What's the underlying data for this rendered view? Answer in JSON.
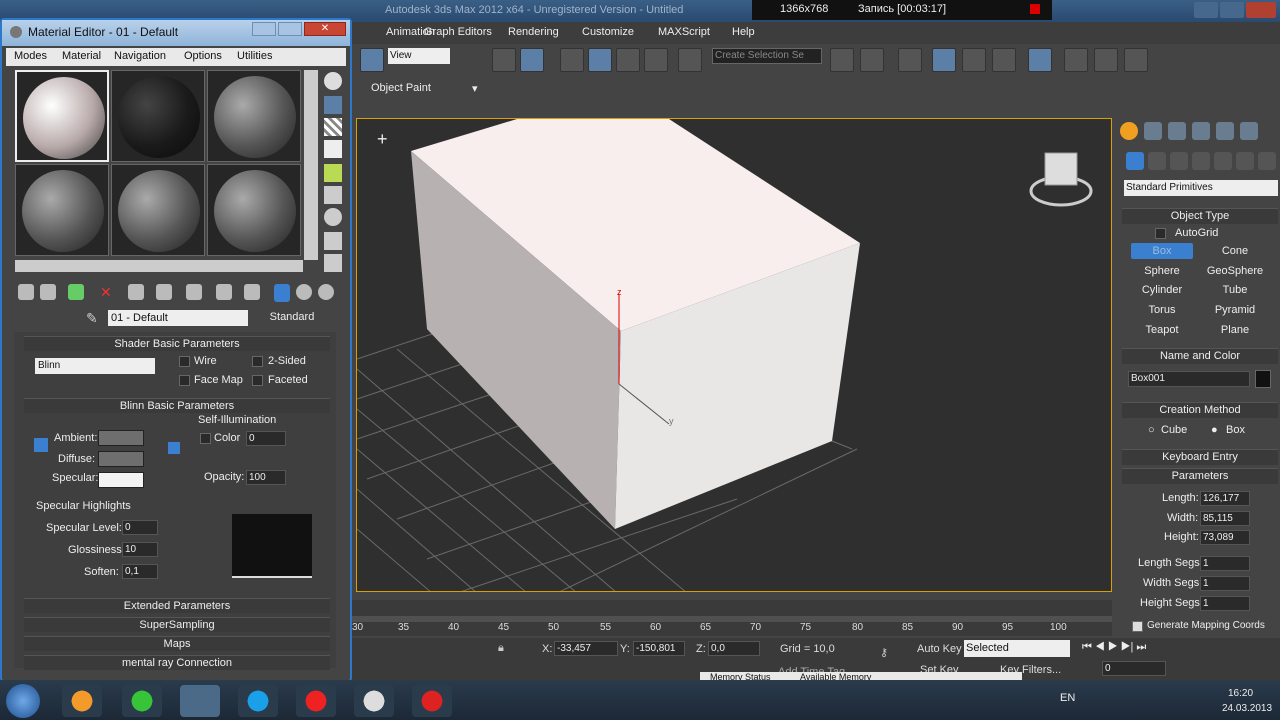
{
  "app": {
    "title": "Autodesk 3ds Max 2012 x64 - Unregistered Version - Untitled"
  },
  "recorder": {
    "resolution": "1366x768",
    "record": "Запись [00:03:17]"
  },
  "menu": [
    "Animation",
    "Graph Editors",
    "Rendering",
    "Customize",
    "MAXScript",
    "Help"
  ],
  "toolbar": {
    "view_select": "View",
    "selection_set_placeholder": "Create Selection Se"
  },
  "subbar": {
    "label": "Object Paint"
  },
  "viewport": {
    "axis_z": "z",
    "axis_y": "y",
    "box_color": "#f6f0f0"
  },
  "timeline": {
    "ticks": [
      "30",
      "35",
      "40",
      "45",
      "50",
      "55",
      "60",
      "65",
      "70",
      "75",
      "80",
      "85",
      "90",
      "95",
      "100"
    ]
  },
  "status": {
    "x_label": "X:",
    "x_value": "-33,457",
    "y_label": "Y:",
    "y_value": "-150,801",
    "z_label": "Z:",
    "z_value": "0,0",
    "grid": "Grid = 10,0",
    "auto_key": "Auto Key",
    "selected": "Selected",
    "set_key": "Set Key",
    "key_filters": "Key Filters...",
    "add_time_tag": "Add Time Tag",
    "frame": "0"
  },
  "memory": {
    "status": "Memory Status",
    "available": "Available Memory"
  },
  "command_panel": {
    "category": "Standard Primitives",
    "object_type_title": "Object Type",
    "autogrid": "AutoGrid",
    "buttons": [
      "Box",
      "Cone",
      "Sphere",
      "GeoSphere",
      "Cylinder",
      "Tube",
      "Torus",
      "Pyramid",
      "Teapot",
      "Plane"
    ],
    "name_color_title": "Name and Color",
    "object_name": "Box001",
    "creation_method_title": "Creation Method",
    "cube": "Cube",
    "box": "Box",
    "keyboard_entry": "Keyboard Entry",
    "parameters_title": "Parameters",
    "length_label": "Length:",
    "length": "126,177",
    "width_label": "Width:",
    "width": "85,115",
    "height_label": "Height:",
    "height": "73,089",
    "length_segs_label": "Length Segs:",
    "length_segs": "1",
    "width_segs_label": "Width Segs:",
    "width_segs": "1",
    "height_segs_label": "Height Segs:",
    "height_segs": "1",
    "gen_mapping": "Generate Mapping Coords"
  },
  "material_editor": {
    "title": "Material Editor - 01 - Default",
    "menu": [
      "Modes",
      "Material",
      "Navigation",
      "Options",
      "Utilities"
    ],
    "material_name": "01 - Default",
    "material_type": "Standard",
    "shader_title": "Shader Basic Parameters",
    "shader": "Blinn",
    "wire": "Wire",
    "two_sided": "2-Sided",
    "face_map": "Face Map",
    "faceted": "Faceted",
    "blinn_title": "Blinn Basic Parameters",
    "self_illum": "Self-Illumination",
    "ambient": "Ambient:",
    "diffuse": "Diffuse:",
    "specular": "Specular:",
    "color": "Color",
    "color_value": "0",
    "opacity": "Opacity:",
    "opacity_value": "100",
    "spec_highlights": "Specular Highlights",
    "spec_level": "Specular Level:",
    "spec_level_value": "0",
    "glossiness": "Glossiness:",
    "glossiness_value": "10",
    "soften": "Soften:",
    "soften_value": "0,1",
    "rollouts": [
      "Extended Parameters",
      "SuperSampling",
      "Maps",
      "mental ray Connection"
    ]
  },
  "tray": {
    "lang": "EN",
    "time": "16:20",
    "date": "24.03.2013"
  }
}
